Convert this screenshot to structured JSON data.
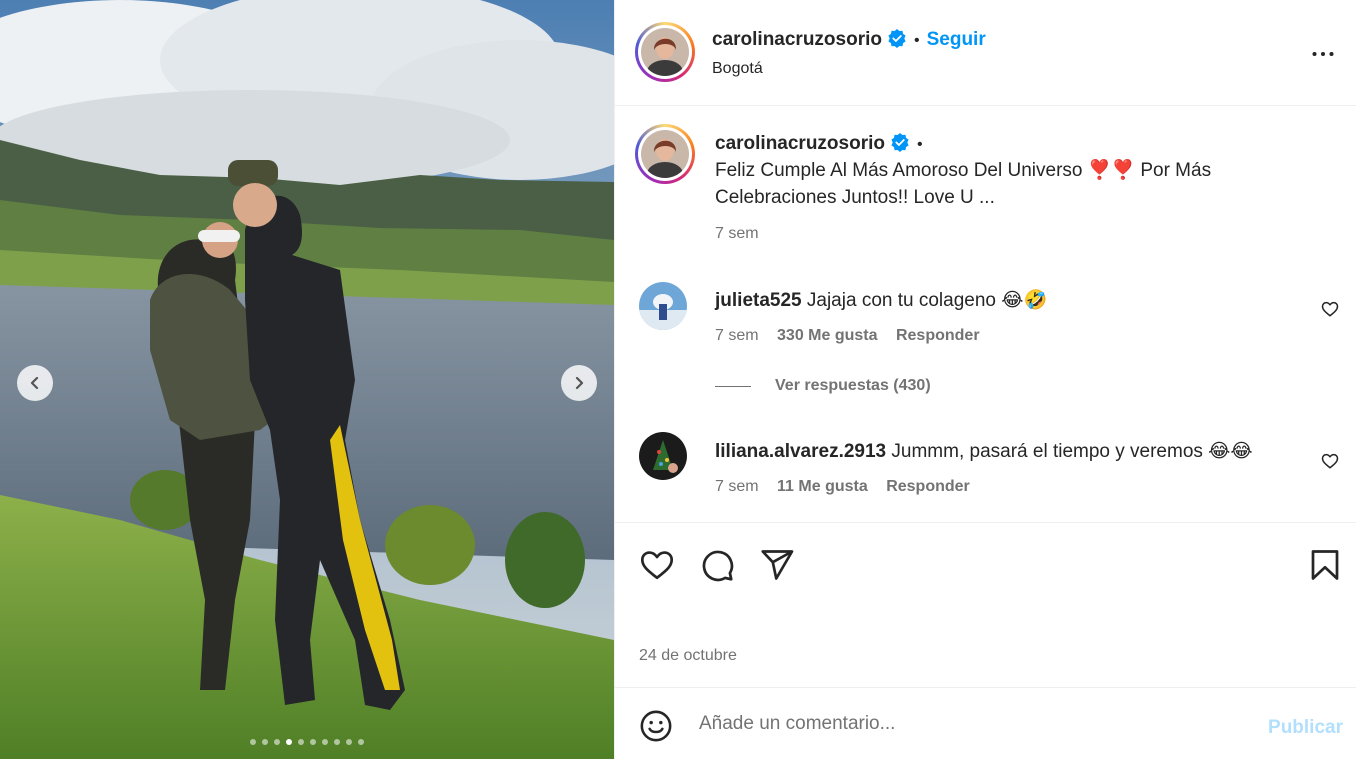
{
  "author": {
    "username": "carolinacruzosorio",
    "location": "Bogotá",
    "follow_label": "Seguir",
    "separator": "•"
  },
  "caption": {
    "username": "carolinacruzosorio",
    "text": "Feliz Cumple Al Más Amoroso Del Universo ❣️❣️ Por Más Celebraciones Juntos!! Love U ...",
    "time": "7 sem"
  },
  "comments": [
    {
      "username": "julieta525",
      "text": "Jajaja con tu colageno 😂🤣",
      "time": "7 sem",
      "likes": "330 Me gusta",
      "reply_label": "Responder",
      "view_replies": "Ver respuestas (430)"
    },
    {
      "username": "liliana.alvarez.2913",
      "text": "Jummm, pasará el tiempo y veremos 😂😂",
      "time": "7 sem",
      "likes": "11 Me gusta",
      "reply_label": "Responder"
    }
  ],
  "post": {
    "date": "24 de octubre",
    "carousel_total": 10,
    "carousel_current": 4
  },
  "composer": {
    "placeholder": "Añade un comentario...",
    "publish_label": "Publicar"
  },
  "colors": {
    "link_blue": "#0095f6",
    "publish_disabled": "#b2dffc",
    "muted_text": "#737373",
    "verified_blue": "#0095f6"
  },
  "icons": [
    "chevron-left-icon",
    "chevron-right-icon",
    "verified-badge-icon",
    "more-options-icon",
    "heart-icon",
    "comment-icon",
    "share-icon",
    "bookmark-icon",
    "emoji-icon"
  ]
}
